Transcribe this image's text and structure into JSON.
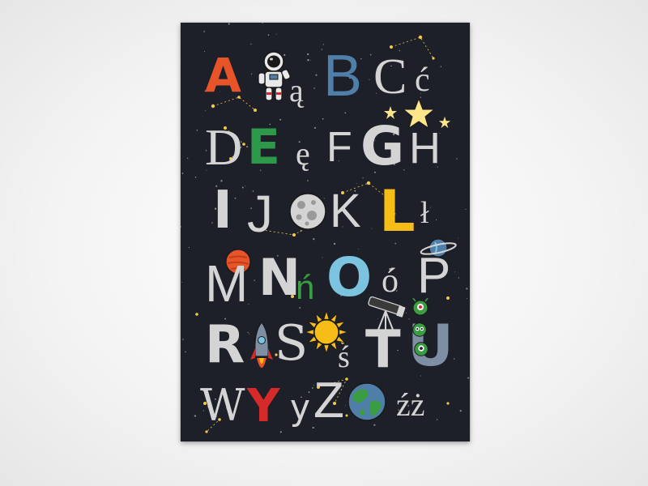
{
  "poster": {
    "letters": {
      "A": "A",
      "A_ogonek": "ą",
      "B": "B",
      "C": "C",
      "C_acute": "ć",
      "D": "D",
      "E": "E",
      "E_ogonek": "ę",
      "F": "F",
      "G": "G",
      "H": "H",
      "I": "I",
      "J": "J",
      "K": "K",
      "L": "L",
      "L_stroke": "ł",
      "M": "M",
      "N": "N",
      "N_acute": "ń",
      "O": "O",
      "O_acute": "ó",
      "P": "P",
      "R": "R",
      "S": "S",
      "S_acute": "ś",
      "T": "T",
      "U": "U",
      "W": "W",
      "Y": "Y",
      "Z": "Z",
      "Z_dot_acute": "źż"
    },
    "colors": {
      "background": "#1d1f29",
      "orange": "#e8542a",
      "blue": "#4f7fa8",
      "green": "#2d9a4a",
      "light_gray": "#d4d4d4",
      "yellow": "#f6bd16",
      "red": "#d62a2a",
      "light_blue": "#7cc3e0",
      "green_n": "#3a9d42"
    },
    "icons": [
      "astronaut-icon",
      "star-icon",
      "moon-icon",
      "planet-saturn-icon",
      "mars-icon",
      "sun-icon",
      "telescope-icon",
      "rocket-icon",
      "alien-icon",
      "earth-icon"
    ]
  }
}
